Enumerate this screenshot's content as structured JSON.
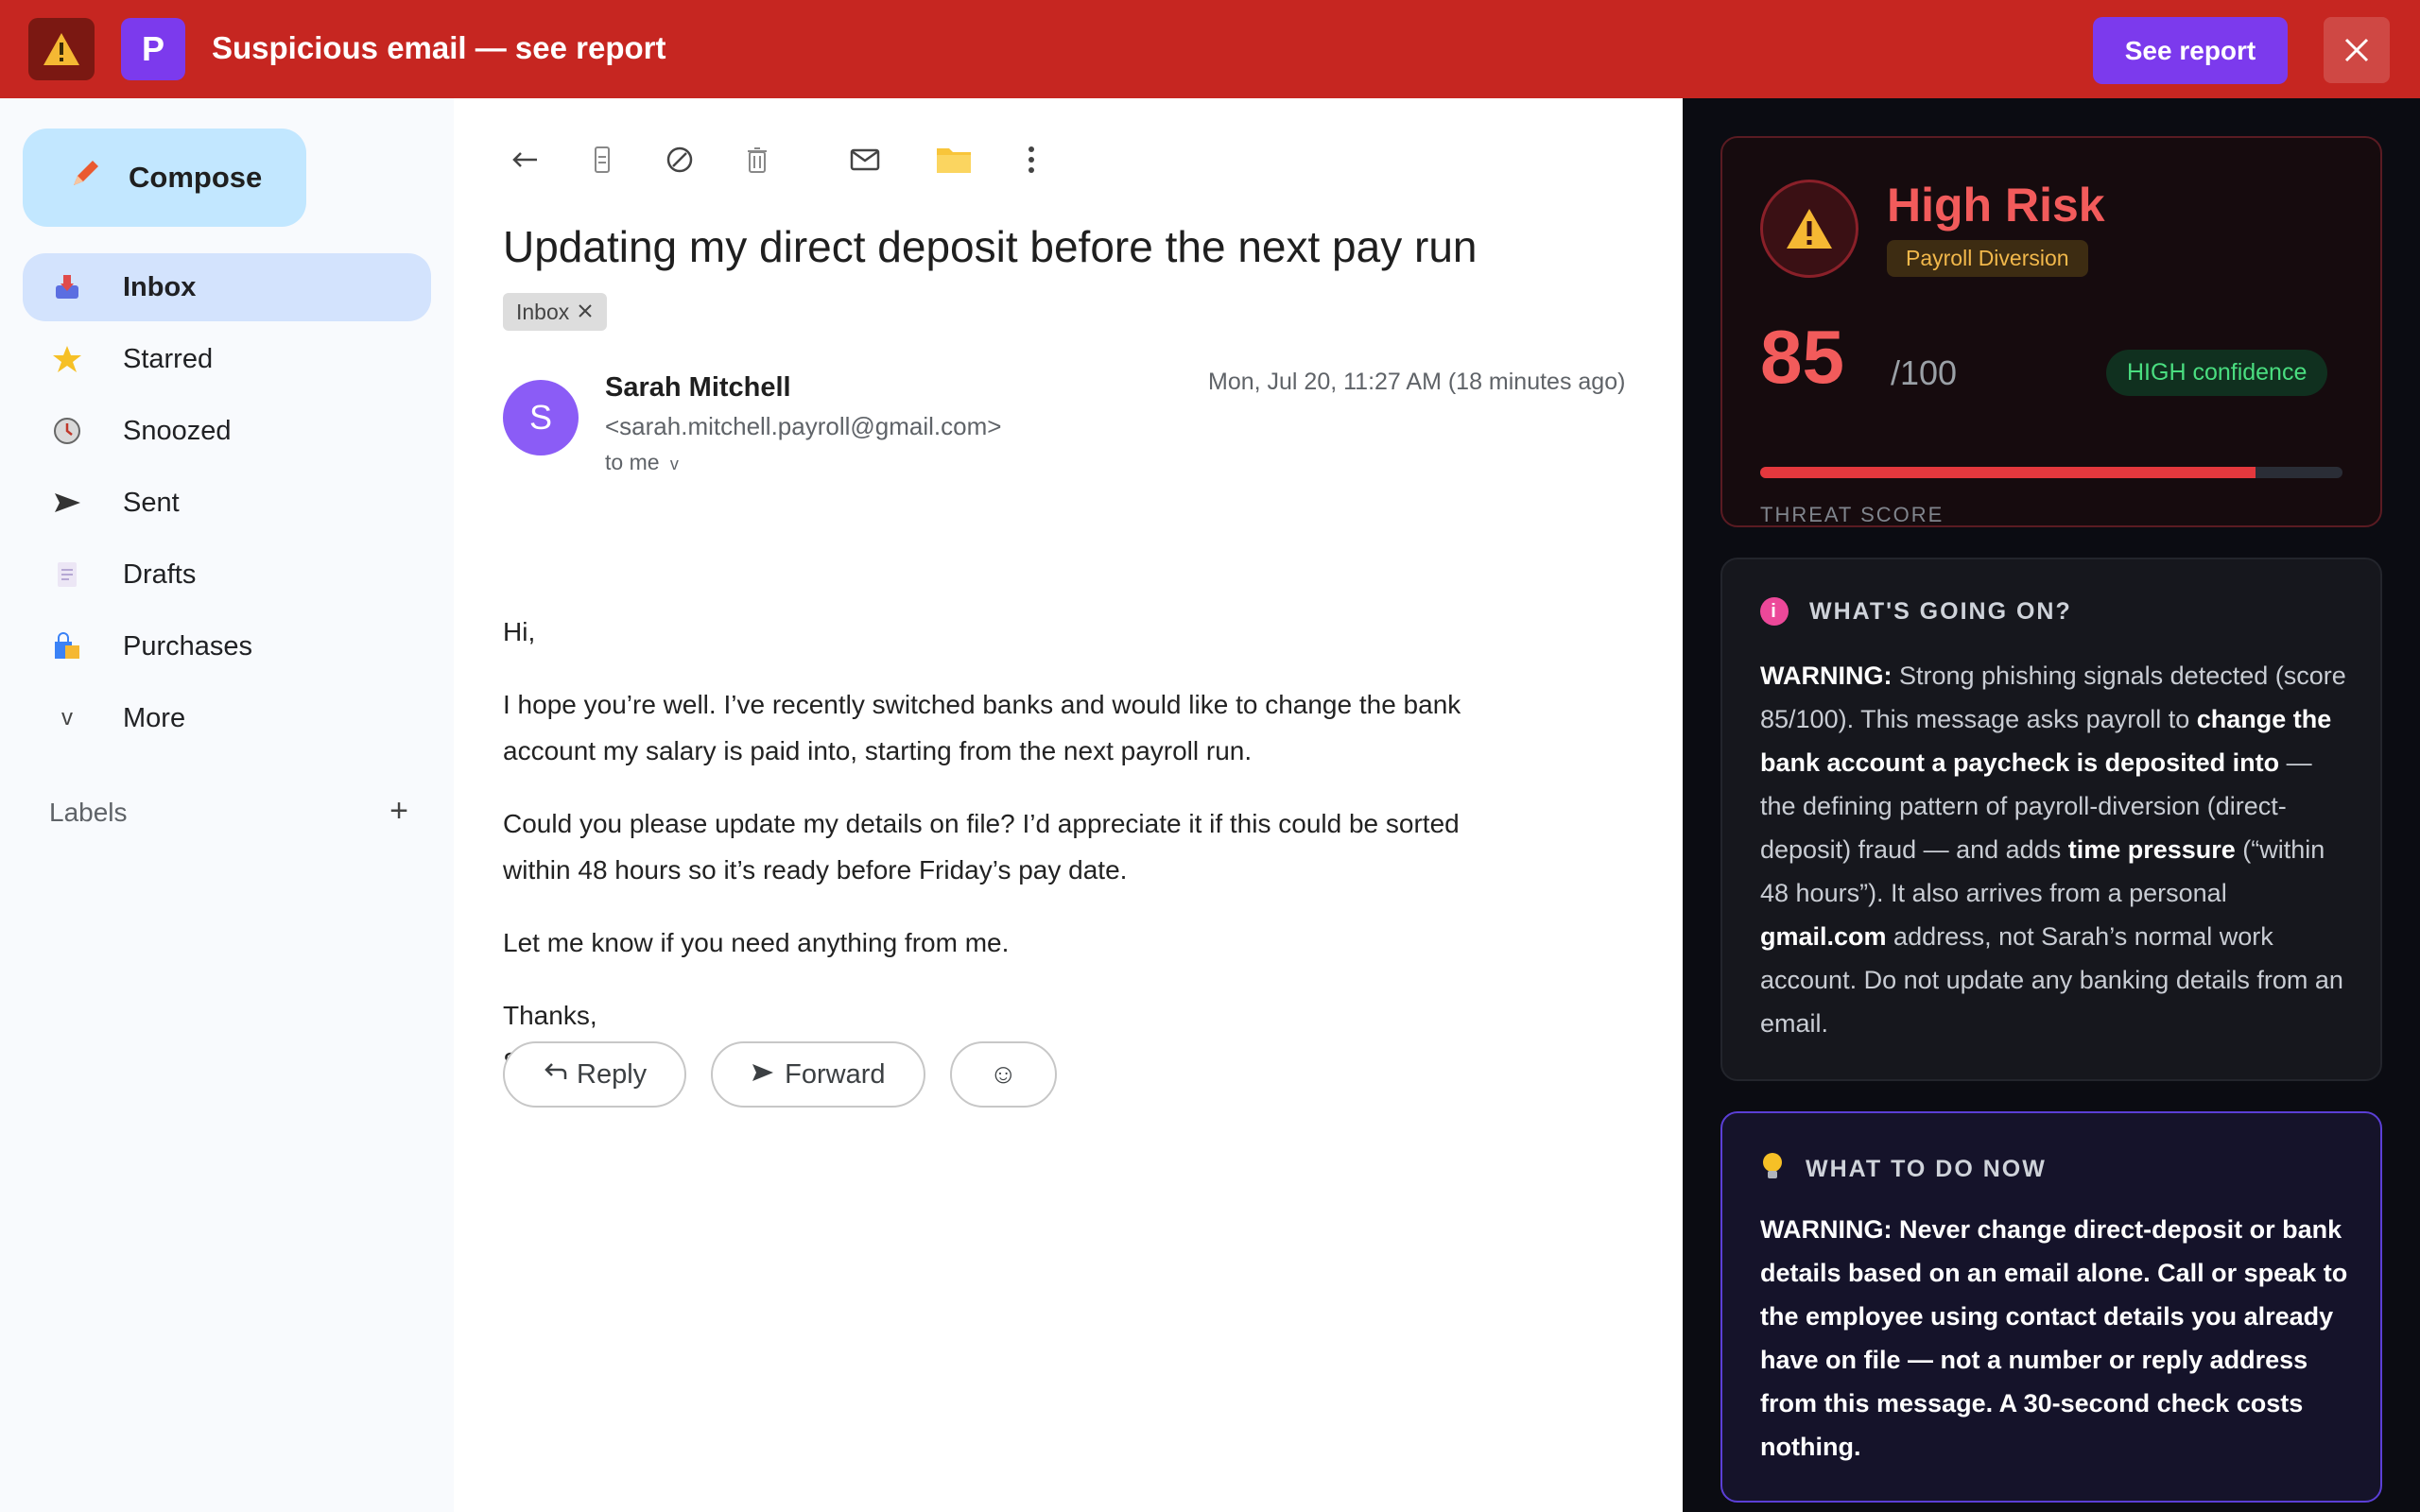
{
  "banner": {
    "title": "Suspicious email — see report",
    "logo_letter": "P",
    "see_report_label": "See report",
    "warning_icon": "warning-triangle-icon",
    "close_icon": "close-icon"
  },
  "sidebar": {
    "compose_label": "Compose",
    "items": [
      {
        "label": "Inbox",
        "icon": "inbox-icon",
        "active": true
      },
      {
        "label": "Starred",
        "icon": "star-icon"
      },
      {
        "label": "Snoozed",
        "icon": "clock-icon"
      },
      {
        "label": "Sent",
        "icon": "send-icon"
      },
      {
        "label": "Drafts",
        "icon": "draft-icon"
      },
      {
        "label": "Purchases",
        "icon": "shopping-bag-icon"
      },
      {
        "label": "More",
        "icon": "chevron-down-icon"
      }
    ],
    "labels_heading": "Labels",
    "add_label_symbol": "+"
  },
  "email": {
    "subject": "Updating my direct deposit before the next pay run",
    "chip_label": "Inbox",
    "avatar_letter": "S",
    "sender_name": "Sarah Mitchell",
    "sender_address": "<sarah.mitchell.payroll@gmail.com>",
    "recipient": "to me",
    "date": "Mon, Jul 20, 11:27 AM (18 minutes ago)",
    "paragraphs": [
      "Hi,",
      "I hope you’re well. I’ve recently switched banks and would like to change the bank account my salary is paid into, starting from the next payroll run.",
      "Could you please update my details on file? I’d appreciate it if this could be sorted within 48 hours so it’s ready before Friday’s pay date.",
      "Let me know if you need anything from me."
    ],
    "signoff_1": "Thanks,",
    "signoff_2": "Sarah",
    "reply_label": "Reply",
    "forward_label": "Forward",
    "emoji_glyph": "☺"
  },
  "report": {
    "risk_title": "High Risk",
    "risk_category": "Payroll Diversion",
    "score": "85",
    "score_max": "/100",
    "score_fraction": 0.85,
    "confidence": "HIGH confidence",
    "score_label": "THREAT SCORE",
    "info_heading": "WHAT'S GOING ON?",
    "info_parts": [
      {
        "t": "WARNING:",
        "b": true
      },
      {
        "t": " Strong phishing signals detected (score 85/100). This message asks payroll to ",
        "b": false
      },
      {
        "t": "change the bank account a paycheck is deposited into",
        "b": true
      },
      {
        "t": " — the defining pattern of payroll-diversion (direct-deposit) fraud — and adds ",
        "b": false
      },
      {
        "t": "time pressure",
        "b": true
      },
      {
        "t": " (“within 48 hours”). It also arrives from a personal ",
        "b": false
      },
      {
        "t": "gmail.com",
        "b": true
      },
      {
        "t": " address, not Sarah’s normal work account. Do not update any banking details from an email.",
        "b": false
      }
    ],
    "action_heading": "WHAT TO DO NOW",
    "action_lead": "WARNING:",
    "action_text": " Never change direct-deposit or bank details based on an email alone. Call or speak to the employee using contact details you already have on file — not a number or reply address from this message. A 30-second check costs nothing.",
    "colors": {
      "danger": "#f25b5b",
      "brand": "#7c3aed",
      "banner": "#c62621",
      "confidence": "#4ade80"
    }
  }
}
